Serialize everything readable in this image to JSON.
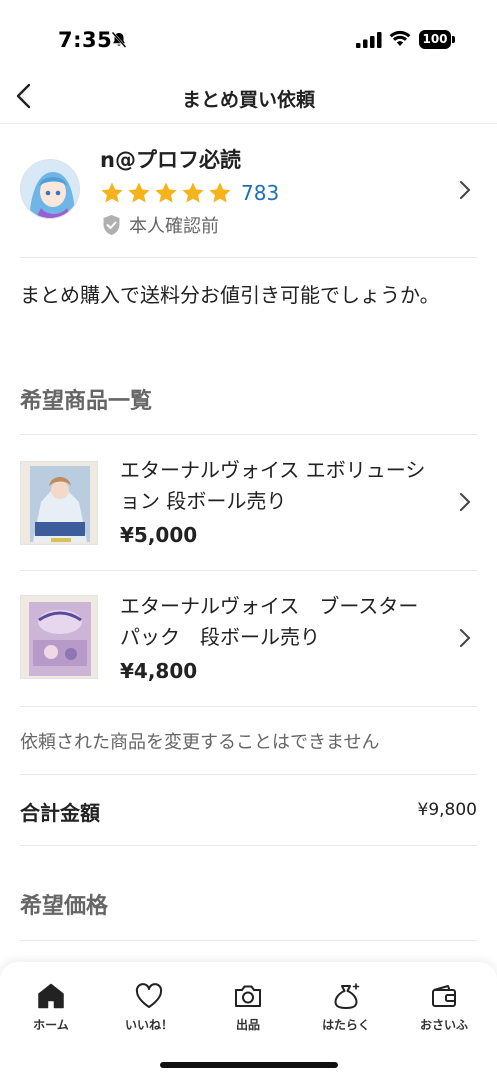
{
  "status_bar": {
    "time": "7:35",
    "battery": "100"
  },
  "nav": {
    "title": "まとめ買い依頼"
  },
  "profile": {
    "name": "n@プロフ必読",
    "rating_stars": 5,
    "rating_count": "783",
    "verification": "本人確認前"
  },
  "message": "まとめ購入で送料分お値引き可能でしょうか。",
  "items_section": {
    "title": "希望商品一覧",
    "items": [
      {
        "name": "エターナルヴォイス エボリューション 段ボール売り",
        "price": "¥5,000"
      },
      {
        "name": "エターナルヴォイス　ブースターパック　段ボール売り",
        "price": "¥4,800"
      }
    ],
    "note": "依頼された商品を変更することはできません"
  },
  "total": {
    "label": "合計金額",
    "value": "¥9,800"
  },
  "desired_price": {
    "title": "希望価格"
  },
  "tab_bar": {
    "tabs": [
      {
        "label": "ホーム",
        "icon": "home-icon"
      },
      {
        "label": "いいね！",
        "icon": "heart-icon"
      },
      {
        "label": "出品",
        "icon": "camera-icon"
      },
      {
        "label": "はたらく",
        "icon": "money-bag-icon"
      },
      {
        "label": "おさいふ",
        "icon": "wallet-icon"
      }
    ]
  },
  "colors": {
    "accent_blue": "#1d6fb8",
    "star": "#f6b41c",
    "text_secondary": "#666666"
  }
}
